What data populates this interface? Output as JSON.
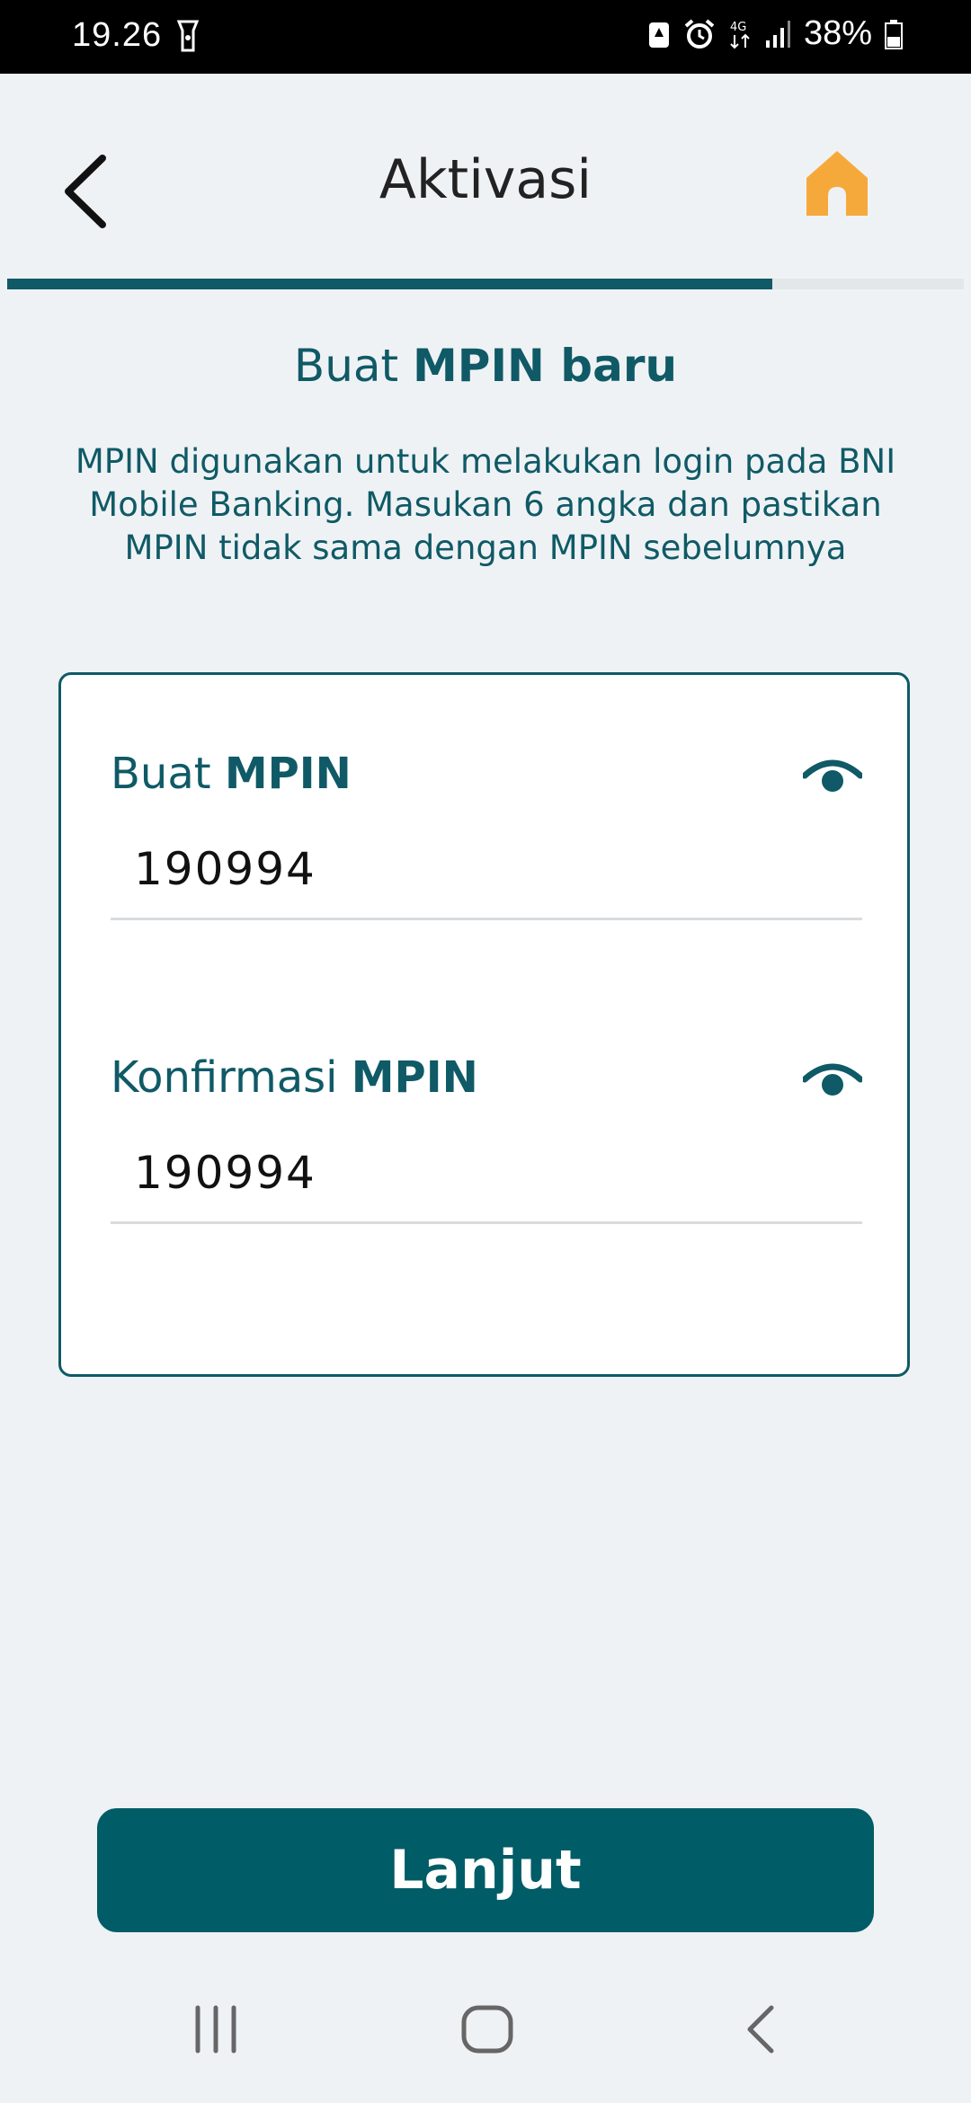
{
  "status_bar": {
    "time": "19.26",
    "battery_text": "38%",
    "icons": [
      "flashlight-icon",
      "saver-icon",
      "alarm-icon",
      "network-4g-icon",
      "signal-icon",
      "battery-icon"
    ]
  },
  "header": {
    "title": "Aktivasi",
    "back_icon": "chevron-left-icon",
    "home_icon": "home-icon",
    "home_color": "#f6a93b",
    "progress": 0.8
  },
  "intro": {
    "subtitle_plain": "Buat ",
    "subtitle_bold": "MPIN baru",
    "description": "MPIN digunakan untuk melakukan login pada BNI Mobile Banking. Masukan 6 angka dan pastikan MPIN tidak sama dengan MPIN sebelumnya"
  },
  "form": {
    "fields": [
      {
        "label_plain": "Buat ",
        "label_bold": "MPIN",
        "value": "190994",
        "icon": "eye-icon"
      },
      {
        "label_plain": "Konfirmasi ",
        "label_bold": "MPIN",
        "value": "190994",
        "icon": "eye-icon"
      }
    ]
  },
  "actions": {
    "continue_label": "Lanjut"
  },
  "colors": {
    "primary": "#0f5a66",
    "button": "#005c66",
    "background": "#eff2f5"
  },
  "nav_bar": {
    "icons": [
      "recent-apps-icon",
      "home-circle-icon",
      "back-icon"
    ]
  }
}
